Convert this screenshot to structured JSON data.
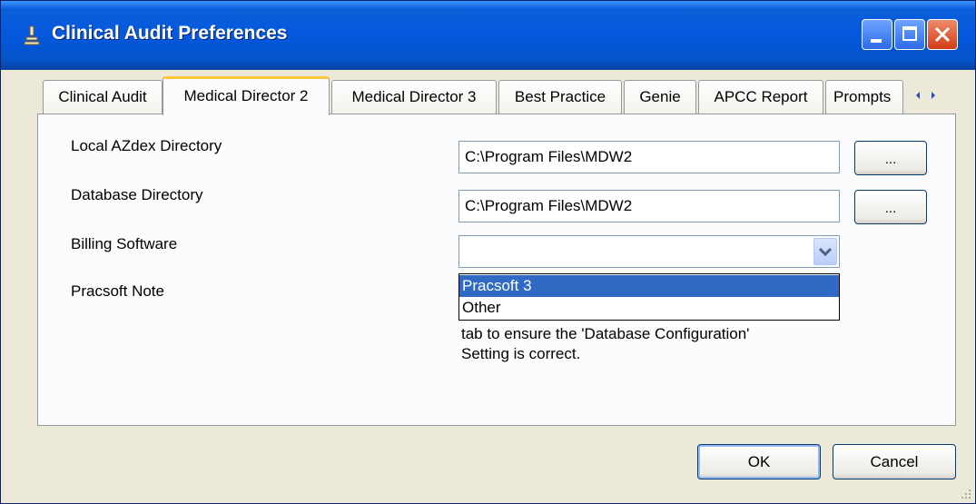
{
  "window": {
    "title": "Clinical Audit Preferences"
  },
  "tabs": [
    {
      "label": "Clinical Audit"
    },
    {
      "label": "Medical Director 2"
    },
    {
      "label": "Medical Director 3"
    },
    {
      "label": "Best Practice"
    },
    {
      "label": "Genie"
    },
    {
      "label": "APCC Report"
    },
    {
      "label": "Prompts"
    }
  ],
  "active_tab": "Medical Director 2",
  "form": {
    "local_azdex": {
      "label": "Local AZdex Directory",
      "value": "C:\\Program Files\\MDW2",
      "browse_label": "..."
    },
    "database_dir": {
      "label": "Database Directory",
      "value": "C:\\Program Files\\MDW2",
      "browse_label": "..."
    },
    "billing": {
      "label": "Billing Software",
      "value": "",
      "options": [
        "Pracsoft 3",
        "Other"
      ],
      "highlighted": "Pracsoft 3"
    },
    "pracsoft_note": {
      "label": "Pracsoft Note",
      "lines": [
        "tab to ensure the 'Database Configuration'",
        "Setting is correct."
      ]
    }
  },
  "buttons": {
    "ok": "OK",
    "cancel": "Cancel"
  },
  "icons": {
    "app": "microscope-icon",
    "minimize": "minimize-icon",
    "maximize": "maximize-icon",
    "close": "close-icon",
    "tab_left": "chevron-left-icon",
    "tab_right": "chevron-right-icon",
    "dropdown": "chevron-down-icon",
    "resize": "resize-grip-icon"
  },
  "colors": {
    "title_bar": "#0558de",
    "selection": "#316ac5",
    "active_tab_accent": "#ffc83c",
    "close_button": "#d23c16"
  }
}
